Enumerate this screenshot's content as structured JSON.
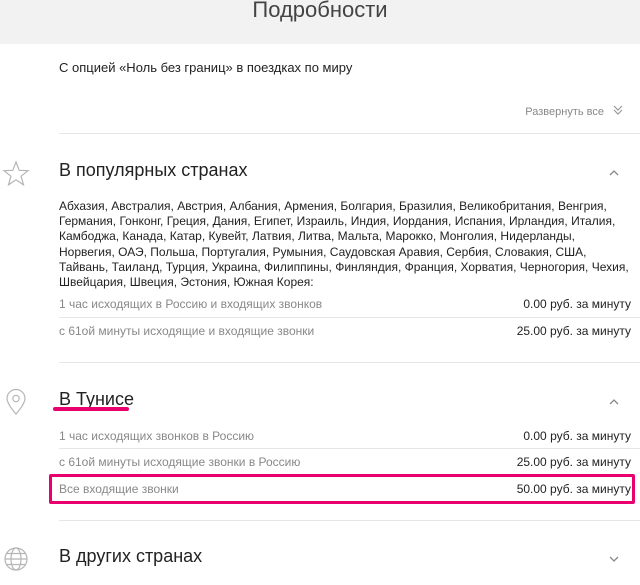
{
  "header": {
    "title": "Подробности"
  },
  "subtitle": "С опцией «Ноль без границ» в поездках по миру",
  "expand_all": {
    "label": "Развернуть все",
    "icon": "double-chevron-down-icon"
  },
  "sections": [
    {
      "title": "В популярных странах",
      "icon": "star-icon",
      "chevron": "chevron-up-icon",
      "countries": "Абхазия, Австралия, Австрия, Албания, Армения, Болгария, Бразилия, Великобритания, Венгрия, Германия, Гонконг, Греция, Дания, Египет, Израиль, Индия, Иордания, Испания, Ирландия, Италия, Камбоджа, Канада, Катар, Кувейт, Латвия, Литва, Мальта, Марокко, Монголия, Нидерланды, Норвегия, ОАЭ, Польша, Португалия, Румыния, Саудовская Аравия, Сербия, Словакия, США, Тайвань, Таиланд, Турция, Украина, Филиппины, Финляндия, Франция, Хорватия, Черногория, Чехия, Швейцария, Швеция, Эстония, Южная Корея:",
      "rates": [
        {
          "label": "1 час исходящих в Россию и входящих звонков",
          "value": "0.00 руб. за минуту"
        },
        {
          "label": "с 61ой минуты исходящие и входящие звонки",
          "value": "25.00 руб. за минуту"
        }
      ]
    },
    {
      "title": "В Тунисе",
      "icon": "map-pin-icon",
      "chevron": "chevron-up-icon",
      "rates": [
        {
          "label": "1 час исходящих звонков в Россию",
          "value": "0.00 руб. за минуту"
        },
        {
          "label": "с 61ой минуты исходящие звонки в Россию",
          "value": "25.00 руб. за минуту"
        },
        {
          "label": "Все входящие звонки",
          "value": "50.00 руб. за минуту"
        }
      ]
    },
    {
      "title": "В других странах",
      "icon": "globe-icon",
      "chevron": "chevron-down-icon"
    }
  ],
  "colors": {
    "accent": "#e8006f",
    "muted_text": "#888888",
    "header_bg": "#f2f2f2"
  }
}
